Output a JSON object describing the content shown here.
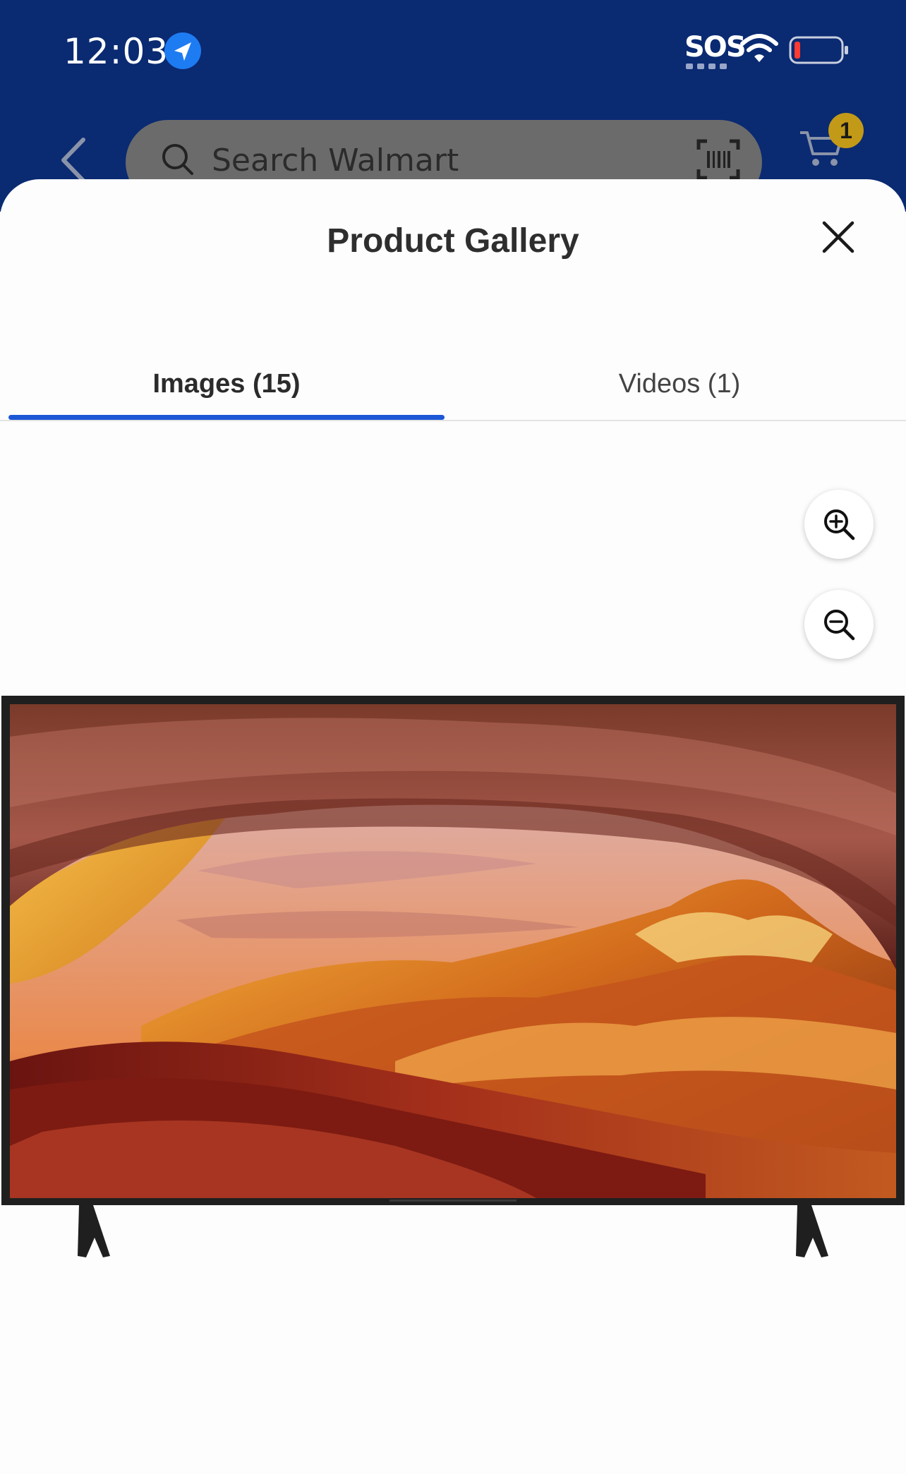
{
  "status_bar": {
    "time": "12:03",
    "carrier_text": "SOS",
    "icons": [
      "location-arrow-icon",
      "wifi-icon",
      "battery-low-icon"
    ]
  },
  "app_bar": {
    "search_placeholder": "Search Walmart",
    "cart_count": "1",
    "icons": [
      "back-chevron-icon",
      "search-icon",
      "barcode-scanner-icon",
      "cart-icon"
    ]
  },
  "gallery": {
    "title": "Product Gallery",
    "tabs": [
      {
        "label": "Images (15)",
        "selected": true
      },
      {
        "label": "Videos (1)",
        "selected": false
      }
    ],
    "controls": [
      "zoom-in-icon",
      "zoom-out-icon",
      "close-icon"
    ]
  },
  "colors": {
    "app_bar_bg": "#0a2a72",
    "tab_accent": "#1c57d6",
    "cart_badge": "#c39a17"
  }
}
